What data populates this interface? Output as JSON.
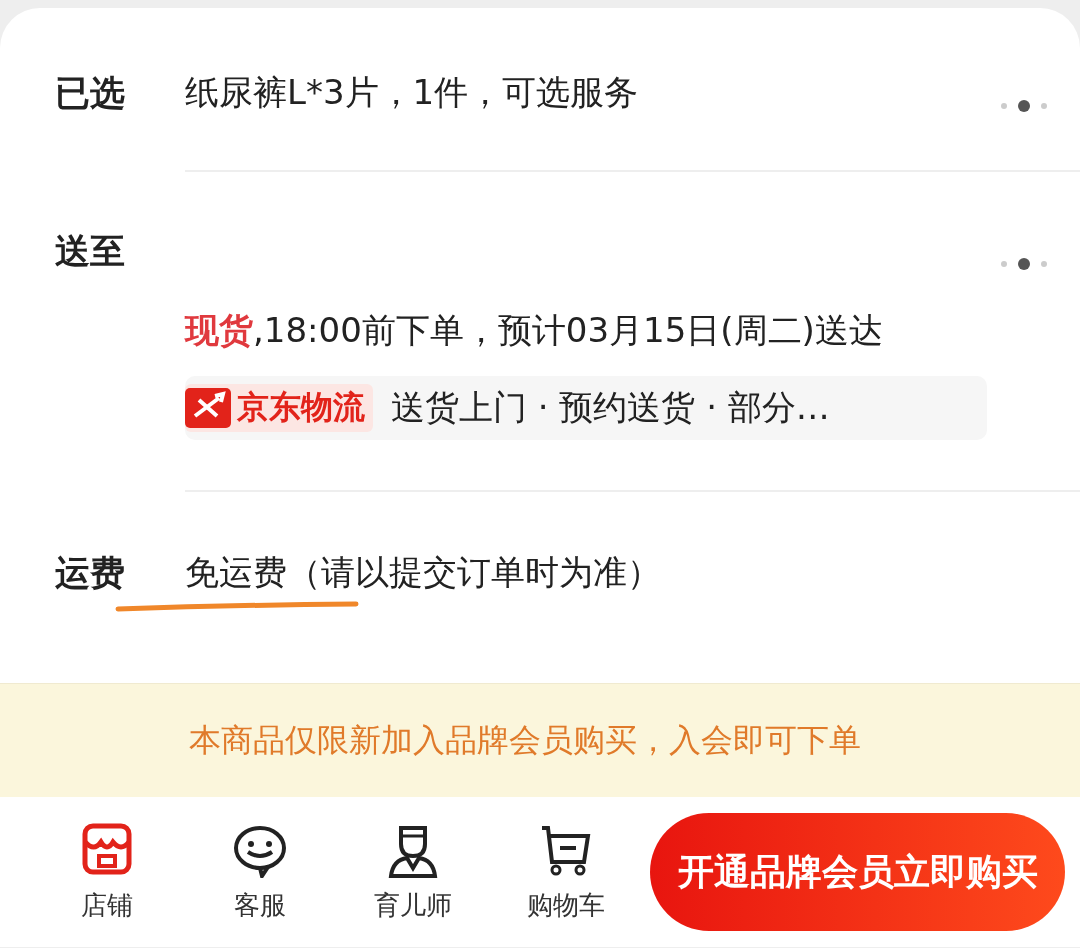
{
  "rows": [
    {
      "kind": "selected",
      "label": "已选",
      "text": "纸尿裤L*3片，1件，可选服务"
    },
    {
      "kind": "delivery",
      "label": "送至",
      "stock_status": "现货",
      "text": ",18:00前下单，预计03月15日(周二)送达",
      "logistics_badge": "京东物流",
      "services": "送货上门 · 预约送货 · 部分…"
    },
    {
      "kind": "shipping",
      "label": "运费",
      "text": "免运费（请以提交订单时为准）"
    }
  ],
  "notice": "本商品仅限新加入品牌会员购买，入会即可下单",
  "nav": [
    {
      "kind": "store",
      "label": "店铺"
    },
    {
      "kind": "service",
      "label": "客服"
    },
    {
      "kind": "advisor",
      "label": "育儿师"
    },
    {
      "kind": "cart",
      "label": "购物车"
    }
  ],
  "buy_button": "开通品牌会员立即购买"
}
